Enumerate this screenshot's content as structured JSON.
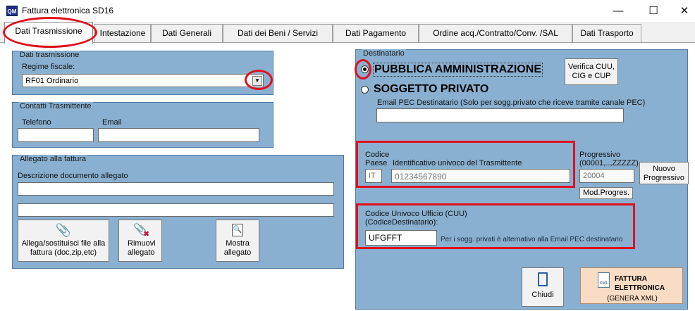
{
  "window": {
    "title": "Fattura elettronica SD16",
    "icon_text": "QM"
  },
  "tabs": [
    {
      "label": "Dati Trasmissione"
    },
    {
      "label": "Intestazione"
    },
    {
      "label": "Dati Generali"
    },
    {
      "label": "Dati dei Beni / Servizi"
    },
    {
      "label": "Dati Pagamento"
    },
    {
      "label": "Ordine acq./Contratto/Conv. /SAL"
    },
    {
      "label": "Dati Trasporto"
    }
  ],
  "dati_trasmissione": {
    "group_title": "Dati trasmissione",
    "regime_label": "Regime fiscale:",
    "regime_value": "RF01 Ordinario"
  },
  "contatti": {
    "group_title": "Contatti Trasmittente",
    "telefono_label": "Telefono",
    "telefono_value": "",
    "email_label": "Email",
    "email_value": ""
  },
  "allegato": {
    "group_title": "Allegato alla fattura",
    "descrizione_label": "Descrizione documento allegato",
    "descrizione_value": "",
    "file_value": "",
    "allega_button": "Allega/sostituisci file alla fattura (doc,zip,etc)",
    "rimuovi_button": "Rimuovi allegato",
    "mostra_button": "Mostra allegato"
  },
  "destinatario": {
    "group_title": "Destinatario",
    "pa_label": "PUBBLICA AMMINISTRAZIONE",
    "privato_label": "SOGGETTO PRIVATO",
    "verifica_button": "Verifica CUU, CIG e CUP",
    "pec_label": "Email PEC Destinatario (Solo per sogg.privato che riceve tramite canale PEC)",
    "pec_value": "",
    "codice_label": "Codice",
    "paese_label": "Paese",
    "paese_value": "IT",
    "identificativo_label": "Identificativo univoco del Trasmittente",
    "identificativo_value": "01234567890",
    "progressivo_label": "Progressivo",
    "progressivo_range": "(00001,..,ZZZZZ)",
    "progressivo_value": "20004",
    "nuovo_button": "Nuovo Progressivo",
    "mod_button": "Mod.Progres.",
    "cuu_label": "Codice Univoco Ufficio (CUU)",
    "cuu_sublabel": "(CodiceDestinatario):",
    "cuu_value": "UFGFFT",
    "cuu_note": "Per i sogg. privati è alternativo alla Email PEC destinatario"
  },
  "actions": {
    "chiudi_button": "Chiudi",
    "fattura_line1": "FATTURA",
    "fattura_line2": "ELETTRONICA",
    "fattura_line3": "(GENERA XML)",
    "xml_icon_text": "XML"
  },
  "colors": {
    "panel": "#89b0d0",
    "highlight": "#e0101d",
    "fattura_button": "#f8dcc3"
  }
}
